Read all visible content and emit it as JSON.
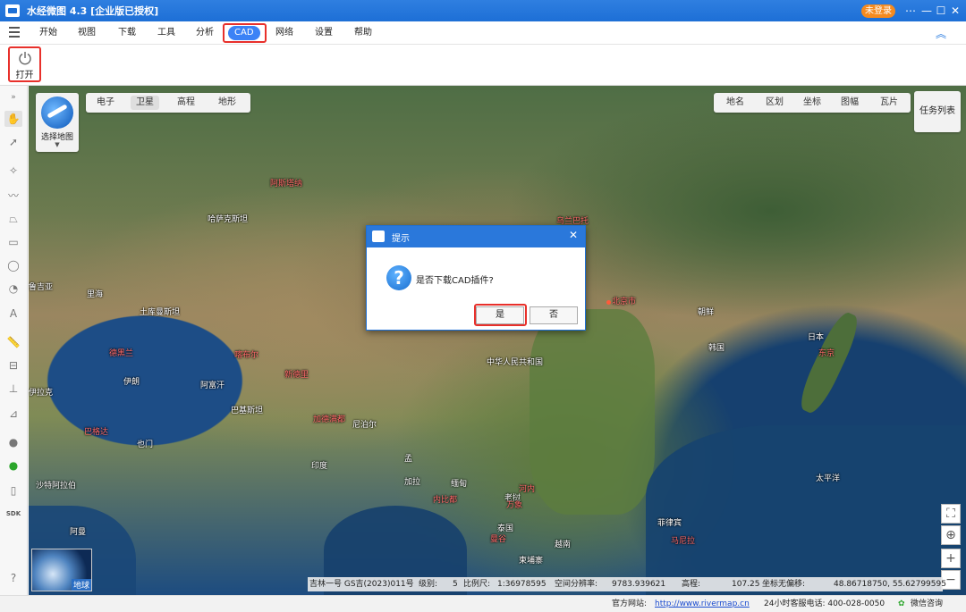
{
  "window": {
    "title": "水经微图 4.3 [企业版已授权]",
    "login_label": "未登录",
    "controls": [
      "⋯",
      "—",
      "☐",
      "✕"
    ]
  },
  "menu": {
    "items": [
      "开始",
      "视图",
      "下载",
      "工具",
      "分析",
      "CAD",
      "网络",
      "设置",
      "帮助"
    ],
    "active": "CAD"
  },
  "ribbon": {
    "open_label": "打开"
  },
  "map": {
    "select_map_label": "选择地图",
    "map_types": [
      "电子",
      "卫星",
      "高程",
      "地形"
    ],
    "selected_map_type": "卫星",
    "layers": [
      "地名",
      "区划",
      "坐标",
      "图幅",
      "瓦片"
    ],
    "task_list_label": "任务列表",
    "minimap_label": "地球",
    "places": {
      "hasakesitan": "哈萨克斯坦",
      "tuerqi": "土库曼斯坦",
      "afuhan": "阿富汗",
      "bajisitan": "巴基斯坦",
      "yilang": "伊朗",
      "yilake": "伊拉克",
      "shate": "沙特阿拉伯",
      "yindu": "印度",
      "niboer": "尼泊尔",
      "zhongguo": "中华人民共和国",
      "chaoxian": "朝鲜",
      "hanguo": "韩国",
      "riben": "日本",
      "taipingyang": "太平洋",
      "feilvbin": "菲律宾",
      "miandian": "缅甸",
      "laowo": "老挝",
      "taiguo": "泰国",
      "jianpuzhai": "柬埔寨",
      "yuenan": "越南",
      "beijing": "北京市",
      "dongjing": "东京",
      "manila": "马尼拉",
      "neibidu": "内比都",
      "henei": "河内",
      "wanxiang": "万象",
      "mangu": "曼谷",
      "jiabuer": "喀布尔",
      "xindeli": "新德里",
      "kamandu": "加德满都",
      "dehelan": "德黑兰",
      "bageda": "巴格达",
      "lihe": "里海",
      "wulanbatuo": "乌兰巴托",
      "mosike": "阿斯塔纳",
      "yemen": "也门",
      "amen": "阿曼",
      "meng": "孟",
      "jiala": "加拉",
      "lugeya": "鲁吉亚"
    }
  },
  "status": {
    "source": "吉林一号 GS吉(2023)011号",
    "level_label": "级别:",
    "level": "5",
    "scale_label": "比例尺:",
    "scale": "1:36978595",
    "resolution_label": "空间分辨率:",
    "resolution": "9783.939621",
    "elevation_label": "高程:",
    "elevation": "107.25",
    "coord_label": "坐标无偏移:",
    "coord": "48.86718750, 55.62799595"
  },
  "footer": {
    "site_label": "官方网站:",
    "site_url": "http://www.rivermap.cn",
    "phone": "24小时客服电话: 400-028-0050",
    "wechat": "微信咨询"
  },
  "dialog": {
    "title": "提示",
    "message": "是否下载CAD插件?",
    "yes_label": "是",
    "no_label": "否"
  },
  "colors": {
    "accent": "#2a78db",
    "highlight_box": "#e8302b",
    "login": "#f58a1f"
  }
}
